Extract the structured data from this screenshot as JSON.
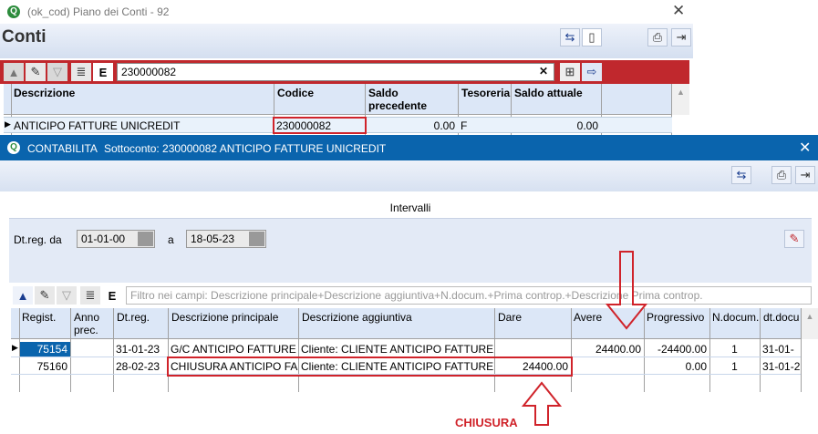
{
  "back_window": {
    "title": "(ok_cod) Piano dei Conti - 92",
    "heading": "Conti",
    "search_value": "230000082",
    "columns": [
      "Descrizione",
      "Codice",
      "Saldo precedente",
      "Tesoreria",
      "Saldo attuale"
    ],
    "row": {
      "descrizione": "ANTICIPO FATTURE UNICREDIT",
      "codice": "230000082",
      "saldo_precedente": "0.00",
      "tesoreria": "F",
      "saldo_attuale": "0.00"
    }
  },
  "front_window": {
    "title": "CONTABILITA",
    "subtitle": "Sottoconto: 230000082 ANTICIPO FATTURE UNICREDIT",
    "intervals_label": "Intervalli",
    "dtreg_label": "Dt.reg. da",
    "date_from": "01-01-00",
    "a_label": "a",
    "date_to": "18-05-23",
    "filter_placeholder": "Filtro nei campi: Descrizione principale+Descrizione aggiuntiva+N.docum.+Prima controp.+Descrizione Prima controp.",
    "columns": [
      "Regist.",
      "Anno prec.",
      "Dt.reg.",
      "Descrizione principale",
      "Descrizione aggiuntiva",
      "Dare",
      "Avere",
      "Progressivo",
      "N.docum.",
      "dt.docu"
    ],
    "rows": [
      {
        "regist": "75154",
        "anno": "",
        "dtreg": "31-01-23",
        "desc": "G/C ANTICIPO FATTURE",
        "desc_agg": "Cliente: CLIENTE ANTICIPO FATTURE",
        "dare": "",
        "avere": "24400.00",
        "progressivo": "-24400.00",
        "ndoc": "1",
        "dtdoc": "31-01-"
      },
      {
        "regist": "75160",
        "anno": "",
        "dtreg": "28-02-23",
        "desc": "CHIUSURA ANTICIPO FA",
        "desc_agg": "Cliente: CLIENTE ANTICIPO FATTURE",
        "dare": "24400.00",
        "avere": "",
        "progressivo": "0.00",
        "ndoc": "1",
        "dtdoc": "31-01-2"
      }
    ]
  },
  "annotation": {
    "label": "CHIUSURA",
    "color": "#d0232a"
  },
  "colors": {
    "blue_title": "#0a64ad",
    "red_toolbar": "#c0282d",
    "accent": "#1a3d8f"
  },
  "icons": [
    "app-logo-icon",
    "close-icon",
    "refresh-icon",
    "new-document-icon",
    "print-icon",
    "exit-icon",
    "up-arrow-icon",
    "edit-icon",
    "filter-icon",
    "list-icon",
    "export-icon",
    "calendar-icon",
    "clear-icon"
  ]
}
